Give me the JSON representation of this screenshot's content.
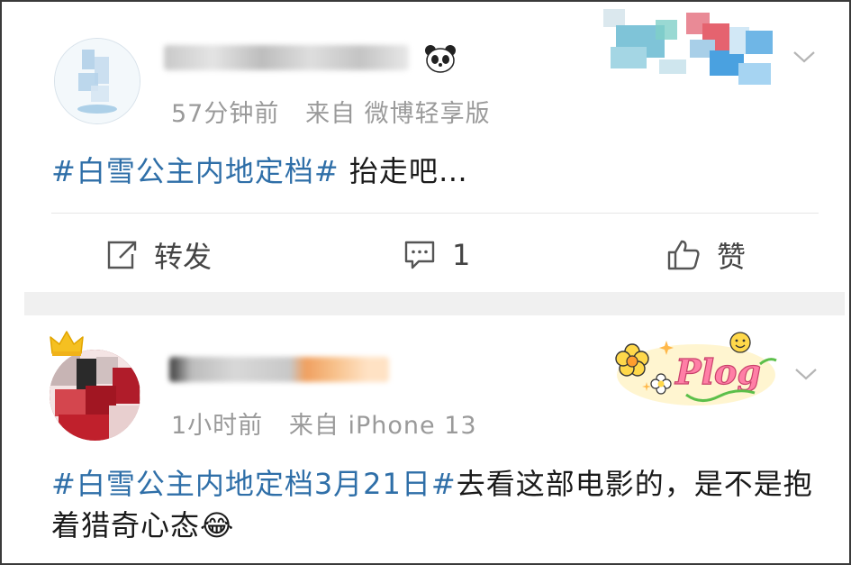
{
  "post1": {
    "meta": "57分钟前   来自 微博轻享版",
    "topic": "#白雪公主内地定档#",
    "text": " 抬走吧…",
    "actions": {
      "repost_label": "转发",
      "comment_count": "1",
      "like_label": "赞"
    }
  },
  "post2": {
    "meta": "1小时前   来自 iPhone 13",
    "topic": "#白雪公主内地定档3月21日#",
    "text": "去看这部电影的，是不是抱着猎奇心态",
    "emoji": "😂",
    "badge": "Plog"
  },
  "icons": {
    "repost": "repost-icon",
    "comment": "comment-icon",
    "like": "thumbs-up-icon",
    "menu": "chevron-down-icon",
    "panda": "panda-icon",
    "crown": "crown-icon"
  },
  "colors": {
    "topic": "#2f6fa8",
    "meta": "#9a9a9a",
    "text": "#1a1a1a",
    "divider": "#f0f0f0"
  }
}
